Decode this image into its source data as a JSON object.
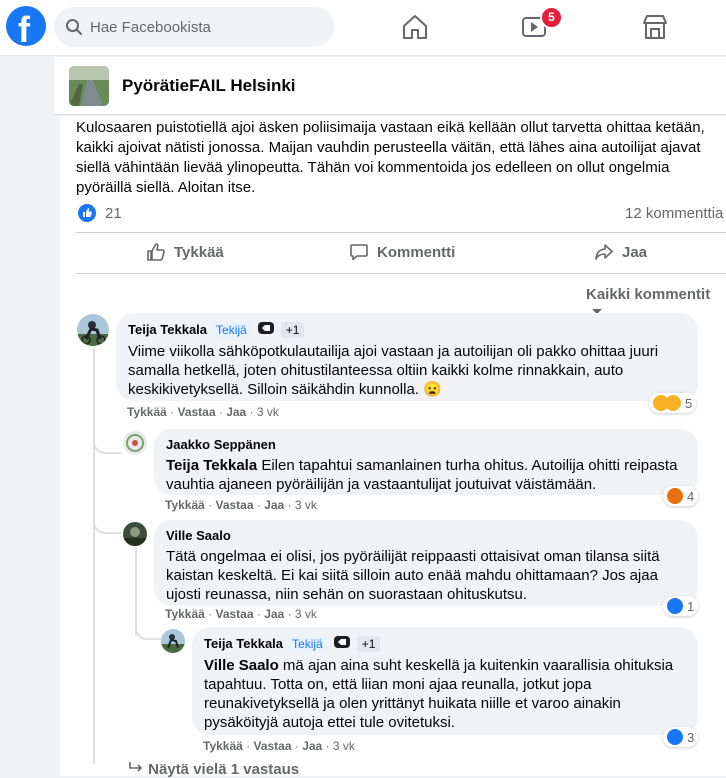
{
  "topbar": {
    "search_placeholder": "Hae Facebookista",
    "logo_letter": "f",
    "video_badge": "5"
  },
  "group": {
    "name": "PyörätieFAIL Helsinki"
  },
  "post": {
    "text": "Kulosaaren puistotiellä ajoi äsken poliisimaija vastaan eikä kellään ollut tarvetta ohittaa ketään, kaikki ajoivat nätisti jonossa. Maijan vauhdin perusteella väitän, että lähes aina autoilijat ajavat siellä vähintään lievää ylinopeutta. Tähän voi kommentoida jos edelleen on ollut ongelmia pyöräillä siellä. Aloitan itse.",
    "like_count": "21",
    "comment_count": "12 kommenttia",
    "actions": {
      "like": "Tykkää",
      "comment": "Kommentti",
      "share": "Jaa"
    },
    "sort_label": "Kaikki kommentit"
  },
  "comments": [
    {
      "author": "Teija Tekkala",
      "tag": "Tekijä",
      "plus": "+1",
      "text": "Viime viikolla sähköpotkulautailija ajoi vastaan ja autoilijan oli pakko ohittaa juuri samalla hetkellä, joten ohitustilanteessa oltiin kaikki kolme rinnakkain, auto keskikivetyksellä. Silloin säikähdin kunnolla. 😦",
      "like": "Tykkää",
      "reply": "Vastaa",
      "share": "Jaa",
      "time": "3 vk",
      "reactions": "5"
    },
    {
      "author": "Jaakko Seppänen",
      "mention": "Teija Tekkala",
      "text": " Eilen tapahtui samanlainen turha ohitus. Autoilija ohitti reipasta vauhtia ajaneen pyöräilijän ja vastaantulijat joutuivat väistämään.",
      "like": "Tykkää",
      "reply": "Vastaa",
      "share": "Jaa",
      "time": "3 vk",
      "reactions": "4"
    },
    {
      "author": "Ville Saalo",
      "text": "Tätä ongelmaa ei olisi, jos pyöräilijät reippaasti ottaisivat oman tilansa siitä kaistan keskeltä. Ei kai siitä silloin auto enää mahdu ohittamaan? Jos ajaa ujosti reunassa, niin sehän on suorastaan ohituskutsu.",
      "like": "Tykkää",
      "reply": "Vastaa",
      "share": "Jaa",
      "time": "3 vk",
      "reactions": "1"
    },
    {
      "author": "Teija Tekkala",
      "tag": "Tekijä",
      "plus": "+1",
      "mention": "Ville Saalo",
      "text": " mä ajan aina suht keskellä ja kuitenkin vaarallisia ohituksia tapahtuu. Totta on, että liian moni ajaa reunalla, jotkut jopa reunakivetyksellä ja olen yrittänyt huikata niille et varoo ainakin pysäköityjä autoja ettei tule ovitetuksi.",
      "like": "Tykkää",
      "reply": "Vastaa",
      "share": "Jaa",
      "time": "3 vk",
      "reactions": "3"
    }
  ],
  "more_replies": "Näytä vielä 1 vastaus",
  "colors": {
    "brand": "#1877f2",
    "badge": "#e41e3f",
    "bubble": "#f0f2f5"
  }
}
